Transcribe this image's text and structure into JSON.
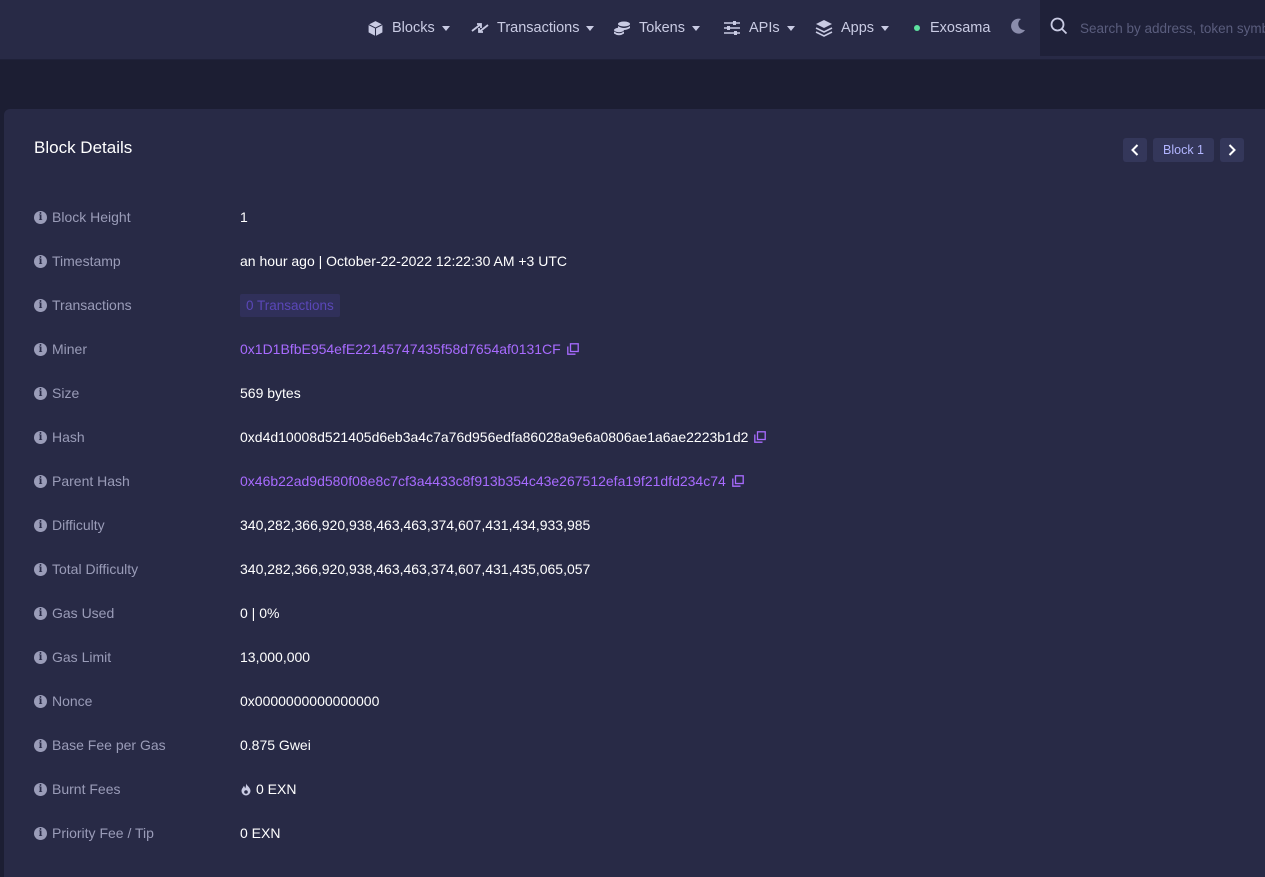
{
  "nav": {
    "items": [
      {
        "label": "Blocks",
        "icon": "cube-icon"
      },
      {
        "label": "Transactions",
        "icon": "transfer-arrows-icon"
      },
      {
        "label": "Tokens",
        "icon": "coins-icon"
      },
      {
        "label": "APIs",
        "icon": "sliders-icon"
      },
      {
        "label": "Apps",
        "icon": "layers-icon"
      }
    ],
    "network": "Exosama",
    "search_placeholder": "Search by address, token symbol, name, transaction hash, or block number"
  },
  "colors": {
    "background": "#1c1e33",
    "card": "#282a46",
    "accent_link": "#a86bff",
    "network_dot": "#5ee2a0"
  },
  "block": {
    "title": "Block Details",
    "pager_label": "Block 1",
    "fields": {
      "height": {
        "label": "Block Height",
        "value": "1"
      },
      "timestamp": {
        "label": "Timestamp",
        "value": "an hour ago | October-22-2022 12:22:30 AM +3 UTC"
      },
      "transactions": {
        "label": "Transactions",
        "value": "0 Transactions"
      },
      "miner": {
        "label": "Miner",
        "value": "0x1D1BfbE954efE22145747435f58d7654af0131CF"
      },
      "size": {
        "label": "Size",
        "value": "569 bytes"
      },
      "hash": {
        "label": "Hash",
        "value": "0xd4d10008d521405d6eb3a4c7a76d956edfa86028a9e6a0806ae1a6ae2223b1d2"
      },
      "parent_hash": {
        "label": "Parent Hash",
        "value": "0x46b22ad9d580f08e8c7cf3a4433c8f913b354c43e267512efa19f21dfd234c74"
      },
      "difficulty": {
        "label": "Difficulty",
        "value": "340,282,366,920,938,463,463,374,607,431,434,933,985"
      },
      "total_difficulty": {
        "label": "Total Difficulty",
        "value": "340,282,366,920,938,463,463,374,607,431,435,065,057"
      },
      "gas_used": {
        "label": "Gas Used",
        "value": "0 | 0%"
      },
      "gas_limit": {
        "label": "Gas Limit",
        "value": "13,000,000"
      },
      "nonce": {
        "label": "Nonce",
        "value": "0x0000000000000000"
      },
      "base_fee": {
        "label": "Base Fee per Gas",
        "value": "0.875 Gwei"
      },
      "burnt_fees": {
        "label": "Burnt Fees",
        "value": "0 EXN"
      },
      "priority_fee": {
        "label": "Priority Fee / Tip",
        "value": "0 EXN"
      }
    }
  }
}
